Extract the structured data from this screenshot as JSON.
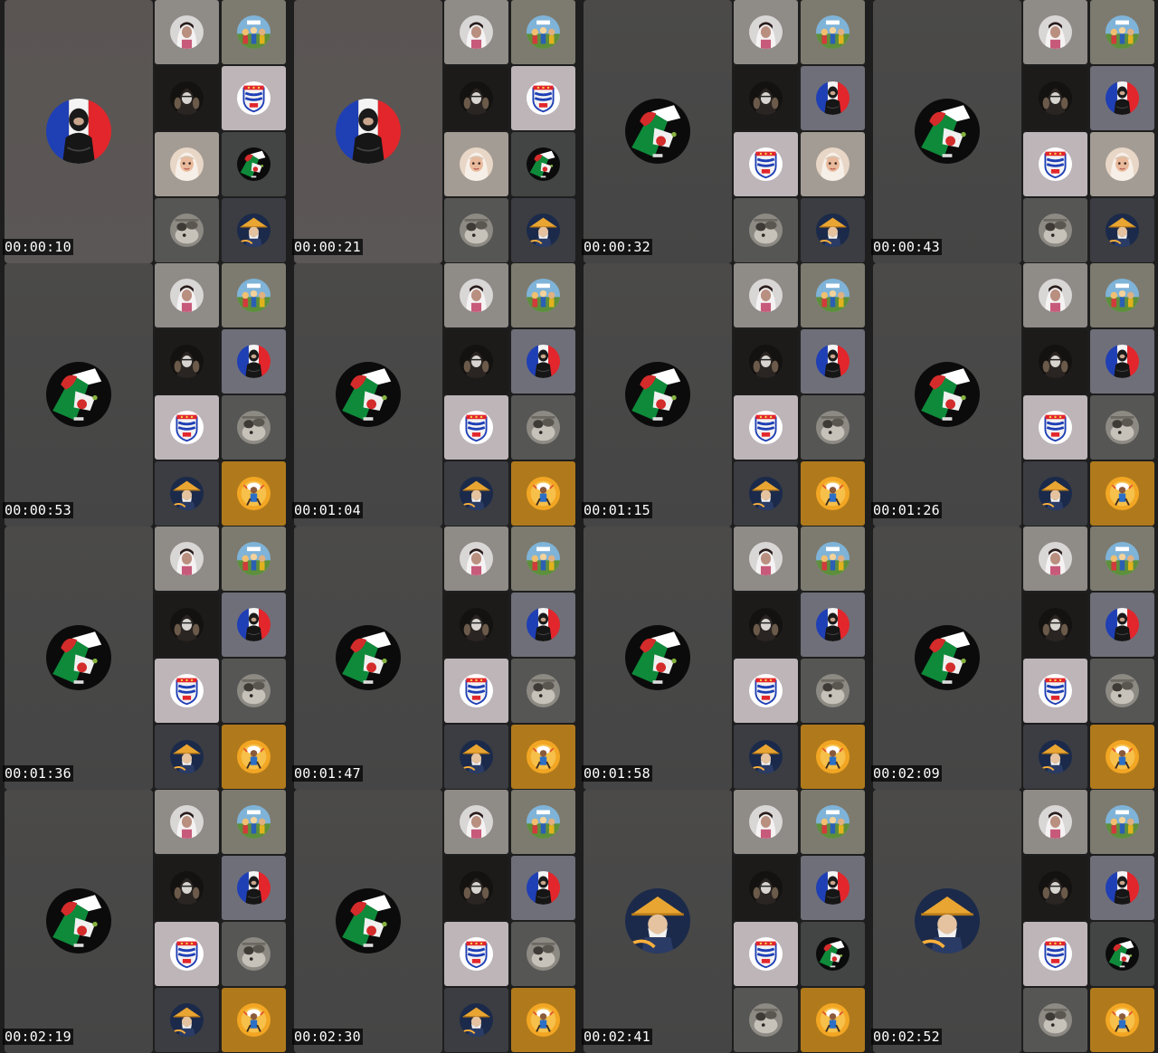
{
  "frames": [
    {
      "time": "00:00:10",
      "main": "avatar-woman-france-flag",
      "tiles": [
        "avatar-girl-white-hijab",
        "avatar-cartoon-crowd",
        "avatar-hooded-figure",
        "avatar-crest-badge",
        "avatar-hijab-cartoon",
        "avatar-hand-algeria-flag",
        "avatar-grey-animal",
        "avatar-samurai-hat"
      ]
    },
    {
      "time": "00:00:21",
      "main": "avatar-woman-france-flag",
      "tiles": [
        "avatar-girl-white-hijab",
        "avatar-cartoon-crowd",
        "avatar-hooded-figure",
        "avatar-crest-badge",
        "avatar-hijab-cartoon",
        "avatar-hand-algeria-flag",
        "avatar-grey-animal",
        "avatar-samurai-hat"
      ]
    },
    {
      "time": "00:00:32",
      "main": "avatar-hand-algeria-flag",
      "tiles": [
        "avatar-girl-white-hijab",
        "avatar-cartoon-crowd",
        "avatar-hooded-figure",
        "avatar-woman-france-flag",
        "avatar-crest-badge",
        "avatar-hijab-cartoon",
        "avatar-grey-animal",
        "avatar-samurai-hat"
      ]
    },
    {
      "time": "00:00:43",
      "main": "avatar-hand-algeria-flag",
      "tiles": [
        "avatar-girl-white-hijab",
        "avatar-cartoon-crowd",
        "avatar-hooded-figure",
        "avatar-woman-france-flag",
        "avatar-crest-badge",
        "avatar-hijab-cartoon",
        "avatar-grey-animal",
        "avatar-samurai-hat"
      ]
    },
    {
      "time": "00:00:53",
      "main": "avatar-hand-algeria-flag",
      "tiles": [
        "avatar-girl-white-hijab",
        "avatar-cartoon-crowd",
        "avatar-hooded-figure",
        "avatar-woman-france-flag",
        "avatar-crest-badge",
        "avatar-grey-animal",
        "avatar-samurai-hat",
        "avatar-orange-character"
      ]
    },
    {
      "time": "00:01:04",
      "main": "avatar-hand-algeria-flag",
      "tiles": [
        "avatar-girl-white-hijab",
        "avatar-cartoon-crowd",
        "avatar-hooded-figure",
        "avatar-woman-france-flag",
        "avatar-crest-badge",
        "avatar-grey-animal",
        "avatar-samurai-hat",
        "avatar-orange-character"
      ]
    },
    {
      "time": "00:01:15",
      "main": "avatar-hand-algeria-flag",
      "tiles": [
        "avatar-girl-white-hijab",
        "avatar-cartoon-crowd",
        "avatar-hooded-figure",
        "avatar-woman-france-flag",
        "avatar-crest-badge",
        "avatar-grey-animal",
        "avatar-samurai-hat",
        "avatar-orange-character"
      ]
    },
    {
      "time": "00:01:26",
      "main": "avatar-hand-algeria-flag",
      "tiles": [
        "avatar-girl-white-hijab",
        "avatar-cartoon-crowd",
        "avatar-hooded-figure",
        "avatar-woman-france-flag",
        "avatar-crest-badge",
        "avatar-grey-animal",
        "avatar-samurai-hat",
        "avatar-orange-character"
      ]
    },
    {
      "time": "00:01:36",
      "main": "avatar-hand-algeria-flag",
      "tiles": [
        "avatar-girl-white-hijab",
        "avatar-cartoon-crowd",
        "avatar-hooded-figure",
        "avatar-woman-france-flag",
        "avatar-crest-badge",
        "avatar-grey-animal",
        "avatar-samurai-hat",
        "avatar-orange-character"
      ]
    },
    {
      "time": "00:01:47",
      "main": "avatar-hand-algeria-flag",
      "tiles": [
        "avatar-girl-white-hijab",
        "avatar-cartoon-crowd",
        "avatar-hooded-figure",
        "avatar-woman-france-flag",
        "avatar-crest-badge",
        "avatar-grey-animal",
        "avatar-samurai-hat",
        "avatar-orange-character"
      ]
    },
    {
      "time": "00:01:58",
      "main": "avatar-hand-algeria-flag",
      "tiles": [
        "avatar-girl-white-hijab",
        "avatar-cartoon-crowd",
        "avatar-hooded-figure",
        "avatar-woman-france-flag",
        "avatar-crest-badge",
        "avatar-grey-animal",
        "avatar-samurai-hat",
        "avatar-orange-character"
      ]
    },
    {
      "time": "00:02:09",
      "main": "avatar-hand-algeria-flag",
      "tiles": [
        "avatar-girl-white-hijab",
        "avatar-cartoon-crowd",
        "avatar-hooded-figure",
        "avatar-woman-france-flag",
        "avatar-crest-badge",
        "avatar-grey-animal",
        "avatar-samurai-hat",
        "avatar-orange-character"
      ]
    },
    {
      "time": "00:02:19",
      "main": "avatar-hand-algeria-flag",
      "tiles": [
        "avatar-girl-white-hijab",
        "avatar-cartoon-crowd",
        "avatar-hooded-figure",
        "avatar-woman-france-flag",
        "avatar-crest-badge",
        "avatar-grey-animal",
        "avatar-samurai-hat",
        "avatar-orange-character"
      ]
    },
    {
      "time": "00:02:30",
      "main": "avatar-hand-algeria-flag",
      "tiles": [
        "avatar-girl-white-hijab",
        "avatar-cartoon-crowd",
        "avatar-hooded-figure",
        "avatar-woman-france-flag",
        "avatar-crest-badge",
        "avatar-grey-animal",
        "avatar-samurai-hat",
        "avatar-orange-character"
      ]
    },
    {
      "time": "00:02:41",
      "main": "avatar-samurai-hat",
      "tiles": [
        "avatar-girl-white-hijab",
        "avatar-cartoon-crowd",
        "avatar-hooded-figure",
        "avatar-woman-france-flag",
        "avatar-crest-badge",
        "avatar-hand-algeria-flag",
        "avatar-grey-animal",
        "avatar-orange-character"
      ]
    },
    {
      "time": "00:02:52",
      "main": "avatar-samurai-hat",
      "tiles": [
        "avatar-girl-white-hijab",
        "avatar-cartoon-crowd",
        "avatar-hooded-figure",
        "avatar-woman-france-flag",
        "avatar-crest-badge",
        "avatar-hand-algeria-flag",
        "avatar-grey-animal",
        "avatar-orange-character"
      ]
    }
  ],
  "tile_backgrounds": {
    "avatar-girl-white-hijab": "#8f8b87",
    "avatar-cartoon-crowd": "#7d7b6f",
    "avatar-hooded-figure": "#1d1b19",
    "avatar-woman-france-flag": "#6f6f7a",
    "avatar-crest-badge": "#bdb5b8",
    "avatar-hijab-cartoon": "#a39c94",
    "avatar-hand-algeria-flag": "#424543",
    "avatar-grey-animal": "#565654",
    "avatar-samurai-hat": "#3b3d42",
    "avatar-orange-character": "#b07a1c"
  },
  "colors": {
    "main_tile_gray": "#484848",
    "main_tile_warm": "#585453",
    "timestamp_bg": "#000000",
    "timestamp_text": "#ffffff"
  }
}
